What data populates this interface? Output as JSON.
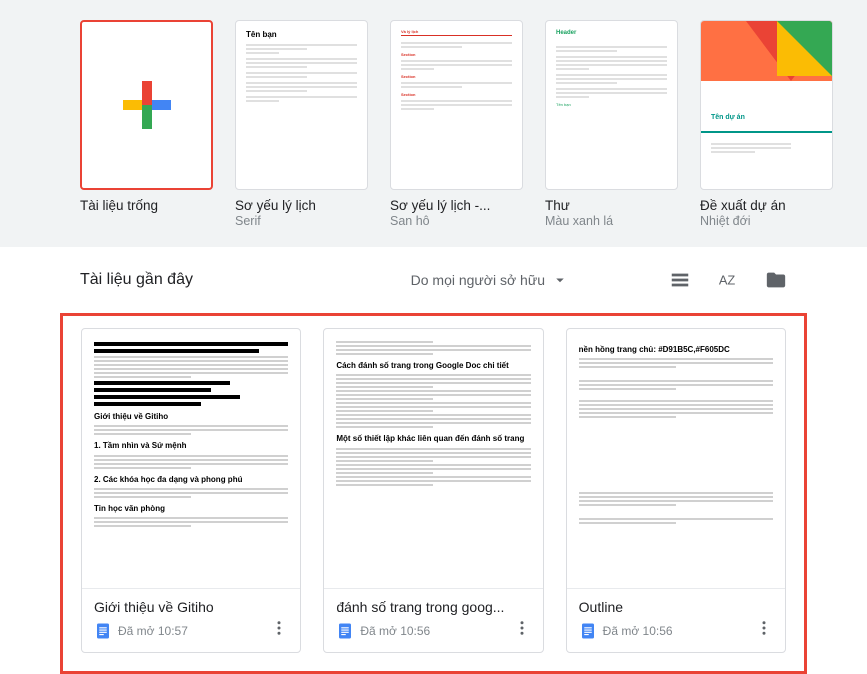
{
  "templates": [
    {
      "title": "Tài liệu trống",
      "subtitle": ""
    },
    {
      "title": "Sơ yếu lý lịch",
      "subtitle": "Serif"
    },
    {
      "title": "Sơ yếu lý lịch -...",
      "subtitle": "San hô"
    },
    {
      "title": "Thư",
      "subtitle": "Màu xanh lá"
    },
    {
      "title": "Đề xuất dự án",
      "subtitle": "Nhiệt đới"
    }
  ],
  "fake_resume_heading": "Tên bạn",
  "fake_project_heading": "Tên dự án",
  "recent_header": "Tài liệu gần đây",
  "owner_filter": "Do mọi người sở hữu",
  "docs": [
    {
      "title": "Giới thiệu về Gitiho",
      "meta": "Đã mở 10:57",
      "preview_heading_1": "Giới thiệu về Gitiho",
      "preview_heading_2": "1. Tầm nhìn và Sứ mệnh",
      "preview_heading_3": "2. Các khóa học đa dạng và phong phú",
      "preview_heading_4": "Tin học văn phòng"
    },
    {
      "title": "đánh số trang trong goog...",
      "meta": "Đã mở 10:56",
      "preview_heading_1": "Cách đánh số trang trong Google Doc chi tiết",
      "preview_heading_2": "Một số thiết lập khác liên quan đến đánh số trang"
    },
    {
      "title": "Outline",
      "meta": "Đã mở 10:56",
      "preview_heading_1": "nền hồng trang chủ: #D91B5C,#F605DC"
    }
  ]
}
